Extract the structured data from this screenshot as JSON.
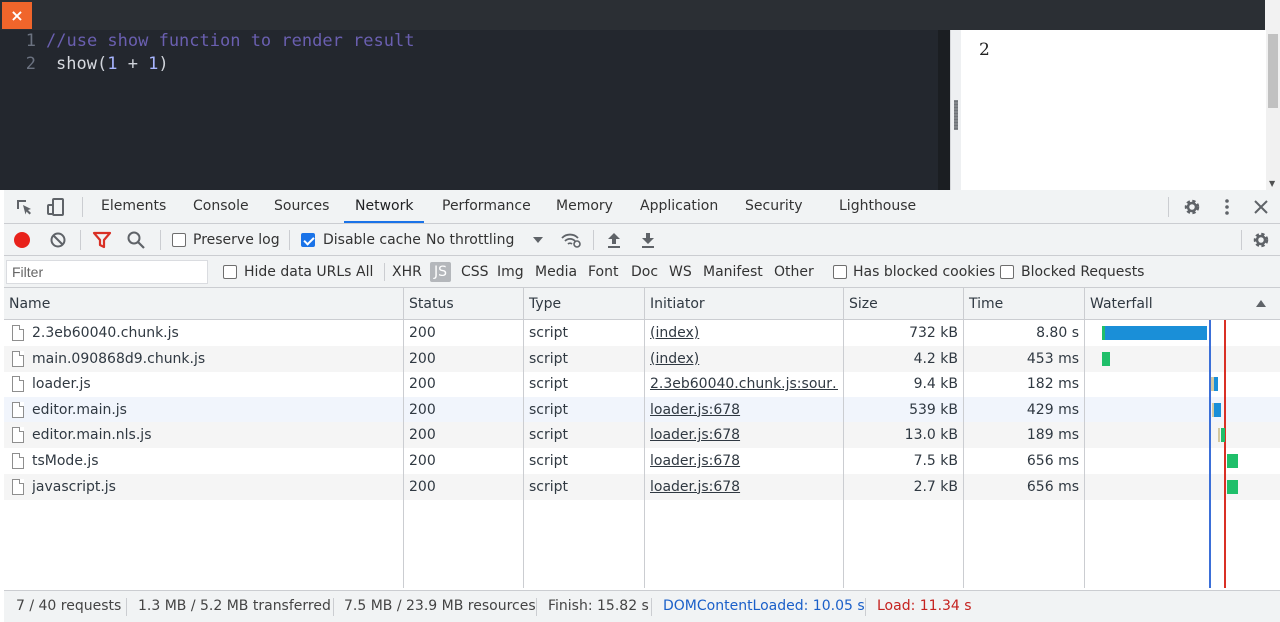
{
  "topbar": {
    "close_label": "×"
  },
  "editor": {
    "lines": [
      {
        "number": "1",
        "comment": "//use show function to render result"
      },
      {
        "number": "2",
        "func": "show",
        "paren_open": "(",
        "arg_a": "1",
        "operator": " + ",
        "arg_b": "1",
        "paren_close": ")"
      }
    ]
  },
  "result": {
    "value": "2"
  },
  "devtools": {
    "tabs": [
      {
        "label": "Elements"
      },
      {
        "label": "Console"
      },
      {
        "label": "Sources"
      },
      {
        "label": "Network",
        "active": true
      },
      {
        "label": "Performance"
      },
      {
        "label": "Memory"
      },
      {
        "label": "Application"
      },
      {
        "label": "Security"
      },
      {
        "label": "Lighthouse"
      }
    ],
    "toolbar": {
      "preserve_log": "Preserve log",
      "preserve_log_checked": false,
      "disable_cache": "Disable cache",
      "disable_cache_checked": true,
      "throttling": "No throttling"
    },
    "filterbar": {
      "filter_placeholder": "Filter",
      "hide_data_urls": "Hide data URLs",
      "types": [
        "All",
        "XHR",
        "JS",
        "CSS",
        "Img",
        "Media",
        "Font",
        "Doc",
        "WS",
        "Manifest",
        "Other"
      ],
      "selected_type": "JS",
      "has_blocked_cookies": "Has blocked cookies",
      "blocked_requests": "Blocked Requests"
    },
    "columns": {
      "name": "Name",
      "status": "Status",
      "type": "Type",
      "initiator": "Initiator",
      "size": "Size",
      "time": "Time",
      "waterfall": "Waterfall"
    },
    "rows": [
      {
        "name": "2.3eb60040.chunk.js",
        "status": "200",
        "type": "script",
        "initiator": "(index)",
        "size": "732 kB",
        "time": "8.80 s"
      },
      {
        "name": "main.090868d9.chunk.js",
        "status": "200",
        "type": "script",
        "initiator": "(index)",
        "size": "4.2 kB",
        "time": "453 ms"
      },
      {
        "name": "loader.js",
        "status": "200",
        "type": "script",
        "initiator": "2.3eb60040.chunk.js:sour…",
        "size": "9.4 kB",
        "time": "182 ms"
      },
      {
        "name": "editor.main.js",
        "status": "200",
        "type": "script",
        "initiator": "loader.js:678",
        "size": "539 kB",
        "time": "429 ms"
      },
      {
        "name": "editor.main.nls.js",
        "status": "200",
        "type": "script",
        "initiator": "loader.js:678",
        "size": "13.0 kB",
        "time": "189 ms"
      },
      {
        "name": "tsMode.js",
        "status": "200",
        "type": "script",
        "initiator": "loader.js:678",
        "size": "7.5 kB",
        "time": "656 ms"
      },
      {
        "name": "javascript.js",
        "status": "200",
        "type": "script",
        "initiator": "loader.js:678",
        "size": "2.7 kB",
        "time": "656 ms"
      }
    ],
    "status": {
      "requests": "7 / 40 requests",
      "transferred": "1.3 MB / 5.2 MB transferred",
      "resources": "7.5 MB / 23.9 MB resources",
      "finish": "Finish: 15.82 s",
      "dom_content_loaded": "DOMContentLoaded: 10.05 s",
      "load": "Load: 11.34 s"
    },
    "colors": {
      "accent": "#1a73e8",
      "record": "#e8221b",
      "filter_active": "#d93025",
      "dcl_line": "#3b6fd8",
      "load_line": "#d93025",
      "wf_receive": "#1a8fd8",
      "wf_wait": "#1fbf6a"
    }
  }
}
